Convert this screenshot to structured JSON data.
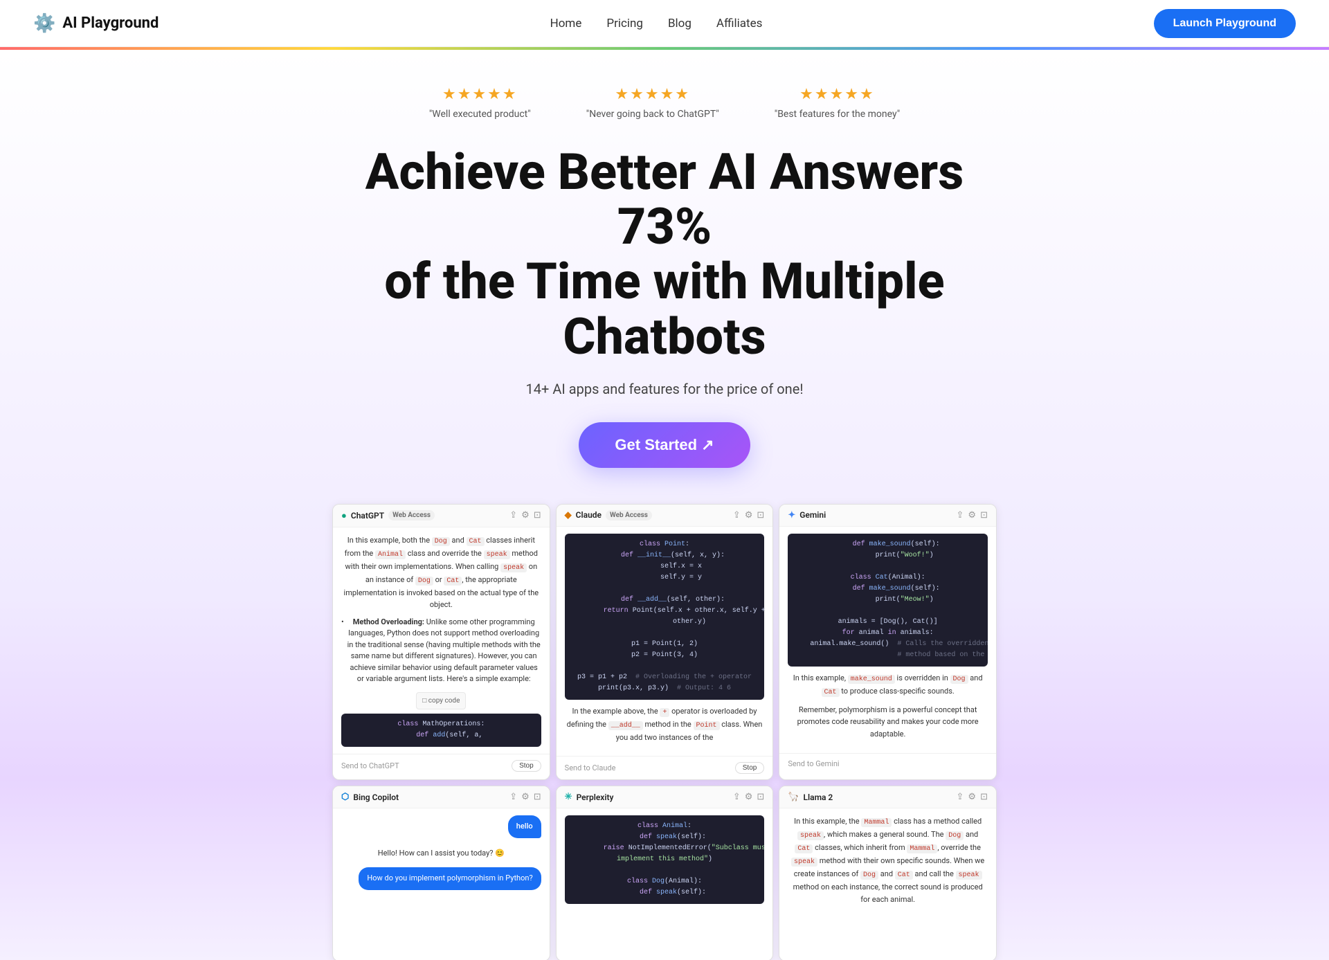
{
  "nav": {
    "logo_icon": "⚙️",
    "logo_text": "AI Playground",
    "links": [
      {
        "label": "Home",
        "id": "home"
      },
      {
        "label": "Pricing",
        "id": "pricing"
      },
      {
        "label": "Blog",
        "id": "blog"
      },
      {
        "label": "Affiliates",
        "id": "affiliates"
      }
    ],
    "cta_label": "Launch Playground"
  },
  "hero": {
    "reviews": [
      {
        "stars": "★★★★★",
        "quote": "\"Well executed product\""
      },
      {
        "stars": "★★★★★",
        "quote": "\"Never going back to ChatGPT\""
      },
      {
        "stars": "★★★★★",
        "quote": "\"Best features for the money\""
      }
    ],
    "headline_line1": "Achieve Better AI Answers 73%",
    "headline_line2": "of the Time with Multiple Chatbots",
    "subline": "14+ AI apps and features for the price of one!",
    "cta_label": "Get Started ↗"
  },
  "panels": {
    "chatgpt": {
      "name": "ChatGPT",
      "web_access": "Web Access",
      "send_to": "Send to ChatGPT",
      "stop": "Stop"
    },
    "claude": {
      "name": "Claude",
      "web_access": "Web Access",
      "send_to": "Send to Claude",
      "stop": "Stop"
    },
    "gemini": {
      "name": "Gemini",
      "web_access": "",
      "send_to": "Send to Gemini",
      "stop": ""
    },
    "bing": {
      "name": "Bing Copilot",
      "web_access": "",
      "send_to": "",
      "stop": ""
    },
    "perplexity": {
      "name": "Perplexity",
      "web_access": "",
      "send_to": "",
      "stop": ""
    },
    "llama": {
      "name": "Llama 2",
      "web_access": "",
      "send_to": "",
      "stop": ""
    }
  }
}
